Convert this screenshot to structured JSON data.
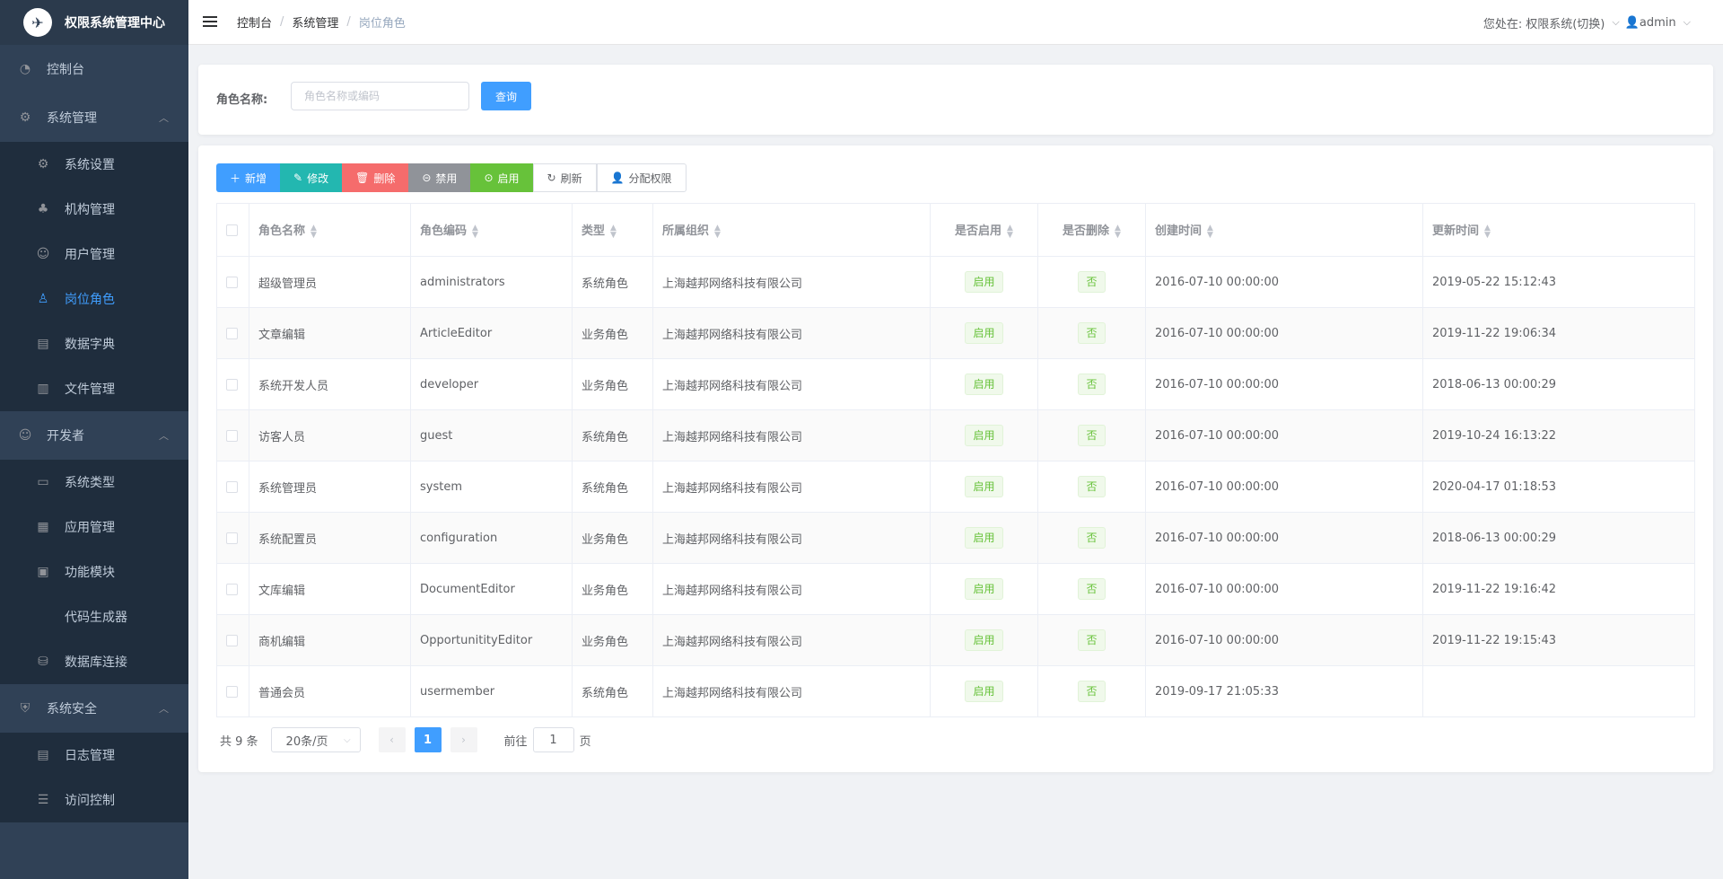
{
  "app": {
    "title": "权限系统管理中心"
  },
  "sidebar": {
    "top": {
      "label": "控制台"
    },
    "groups": [
      {
        "label": "系统管理",
        "items": [
          {
            "label": "系统设置",
            "icon": "gear-icon"
          },
          {
            "label": "机构管理",
            "icon": "org-tree-icon"
          },
          {
            "label": "用户管理",
            "icon": "user-manage-icon"
          },
          {
            "label": "岗位角色",
            "icon": "user-icon",
            "active": true
          },
          {
            "label": "数据字典",
            "icon": "dictionary-icon"
          },
          {
            "label": "文件管理",
            "icon": "file-icon"
          }
        ]
      },
      {
        "label": "开发者",
        "items": [
          {
            "label": "系统类型",
            "icon": "window-icon"
          },
          {
            "label": "应用管理",
            "icon": "grid-icon"
          },
          {
            "label": "功能模块",
            "icon": "modules-icon"
          },
          {
            "label": "代码生成器",
            "icon": "code-icon"
          },
          {
            "label": "数据库连接",
            "icon": "database-icon"
          }
        ]
      },
      {
        "label": "系统安全",
        "items": [
          {
            "label": "日志管理",
            "icon": "log-icon"
          },
          {
            "label": "访问控制",
            "icon": "access-icon"
          }
        ]
      }
    ]
  },
  "header": {
    "breadcrumb": [
      "控制台",
      "系统管理",
      "岗位角色"
    ],
    "location_label": "您处在:",
    "system_switch": "权限系统(切换)",
    "user": "admin"
  },
  "search": {
    "label": "角色名称:",
    "placeholder": "角色名称或编码",
    "query_button": "查询"
  },
  "toolbar": {
    "add": "新增",
    "edit": "修改",
    "delete": "删除",
    "disable": "禁用",
    "enable": "启用",
    "refresh": "刷新",
    "assign": "分配权限"
  },
  "table": {
    "columns": [
      "角色名称",
      "角色编码",
      "类型",
      "所属组织",
      "是否启用",
      "是否删除",
      "创建时间",
      "更新时间"
    ],
    "rows": [
      {
        "name": "超级管理员",
        "code": "administrators",
        "type": "系统角色",
        "org": "上海越邦网络科技有限公司",
        "enabled": "启用",
        "deleted": "否",
        "created": "2016-07-10 00:00:00",
        "updated": "2019-05-22 15:12:43"
      },
      {
        "name": "文章编辑",
        "code": "ArticleEditor",
        "type": "业务角色",
        "org": "上海越邦网络科技有限公司",
        "enabled": "启用",
        "deleted": "否",
        "created": "2016-07-10 00:00:00",
        "updated": "2019-11-22 19:06:34"
      },
      {
        "name": "系统开发人员",
        "code": "developer",
        "type": "业务角色",
        "org": "上海越邦网络科技有限公司",
        "enabled": "启用",
        "deleted": "否",
        "created": "2016-07-10 00:00:00",
        "updated": "2018-06-13 00:00:29"
      },
      {
        "name": "访客人员",
        "code": "guest",
        "type": "系统角色",
        "org": "上海越邦网络科技有限公司",
        "enabled": "启用",
        "deleted": "否",
        "created": "2016-07-10 00:00:00",
        "updated": "2019-10-24 16:13:22"
      },
      {
        "name": "系统管理员",
        "code": "system",
        "type": "系统角色",
        "org": "上海越邦网络科技有限公司",
        "enabled": "启用",
        "deleted": "否",
        "created": "2016-07-10 00:00:00",
        "updated": "2020-04-17 01:18:53"
      },
      {
        "name": "系统配置员",
        "code": "configuration",
        "type": "业务角色",
        "org": "上海越邦网络科技有限公司",
        "enabled": "启用",
        "deleted": "否",
        "created": "2016-07-10 00:00:00",
        "updated": "2018-06-13 00:00:29"
      },
      {
        "name": "文库编辑",
        "code": "DocumentEditor",
        "type": "业务角色",
        "org": "上海越邦网络科技有限公司",
        "enabled": "启用",
        "deleted": "否",
        "created": "2016-07-10 00:00:00",
        "updated": "2019-11-22 19:16:42"
      },
      {
        "name": "商机编辑",
        "code": "OpportunitityEditor",
        "type": "业务角色",
        "org": "上海越邦网络科技有限公司",
        "enabled": "启用",
        "deleted": "否",
        "created": "2016-07-10 00:00:00",
        "updated": "2019-11-22 19:15:43"
      },
      {
        "name": "普通会员",
        "code": "usermember",
        "type": "系统角色",
        "org": "上海越邦网络科技有限公司",
        "enabled": "启用",
        "deleted": "否",
        "created": "2019-09-17 21:05:33",
        "updated": ""
      }
    ]
  },
  "pagination": {
    "total": "共 9 条",
    "page_size": "20条/页",
    "current_page": "1",
    "goto_label": "前往",
    "goto_value": "1",
    "page_suffix": "页"
  }
}
